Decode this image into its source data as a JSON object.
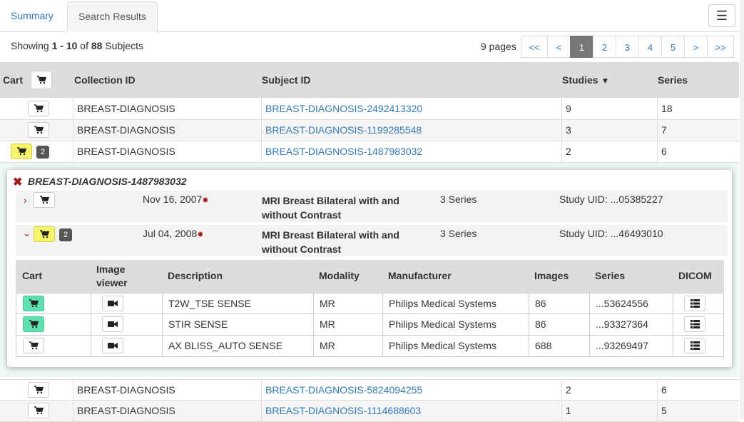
{
  "tabs": [
    {
      "label": "Summary"
    },
    {
      "label": "Search Results"
    }
  ],
  "results": {
    "showing_prefix": "Showing ",
    "range": "1 - 10",
    "of": " of ",
    "total": "88",
    "suffix": " Subjects"
  },
  "pagination": {
    "pages_label": "9 pages",
    "first": "<<",
    "prev": "<",
    "pages": [
      "1",
      "2",
      "3",
      "4",
      "5"
    ],
    "next": ">",
    "last": ">>"
  },
  "table": {
    "headers": {
      "cart": "Cart",
      "collection": "Collection ID",
      "subject": "Subject ID",
      "studies": "Studies",
      "series": "Series"
    },
    "rows_top": [
      {
        "collection": "BREAST-DIAGNOSIS",
        "subject": "BREAST-DIAGNOSIS-2492413320",
        "studies": "9",
        "series": "18"
      },
      {
        "collection": "BREAST-DIAGNOSIS",
        "subject": "BREAST-DIAGNOSIS-1199285548",
        "studies": "3",
        "series": "7"
      },
      {
        "collection": "BREAST-DIAGNOSIS",
        "subject": "BREAST-DIAGNOSIS-1487983032",
        "studies": "2",
        "series": "6",
        "badge": "2"
      }
    ],
    "rows_bottom": [
      {
        "collection": "BREAST-DIAGNOSIS",
        "subject": "BREAST-DIAGNOSIS-5824094255",
        "studies": "2",
        "series": "6"
      },
      {
        "collection": "BREAST-DIAGNOSIS",
        "subject": "BREAST-DIAGNOSIS-1114688603",
        "studies": "1",
        "series": "5"
      }
    ]
  },
  "detail": {
    "title": "BREAST-DIAGNOSIS-1487983032",
    "studies": [
      {
        "date": "Nov 16, 2007",
        "star": "✸",
        "desc_line1": "MRI Breast Bilateral with and",
        "desc_line2": "without Contrast",
        "series": "3 Series",
        "uid": "Study UID: ...05385227"
      },
      {
        "date": "Jul 04, 2008",
        "star": "✸",
        "desc_line1": "MRI Breast Bilateral with and",
        "desc_line2": "without Contrast",
        "series": "3 Series",
        "uid": "Study UID: ...46493010",
        "badge": "2"
      }
    ],
    "series_headers": {
      "cart": "Cart",
      "viewer_line1": "Image",
      "viewer_line2": "viewer",
      "description": "Description",
      "modality": "Modality",
      "manufacturer": "Manufacturer",
      "images": "Images",
      "series": "Series",
      "dicom": "DICOM"
    },
    "series_rows": [
      {
        "description": "T2W_TSE SENSE",
        "modality": "MR",
        "manufacturer": "Philips Medical Systems",
        "images": "86",
        "series": "...53624556"
      },
      {
        "description": "STIR SENSE",
        "modality": "MR",
        "manufacturer": "Philips Medical Systems",
        "images": "86",
        "series": "...93327364"
      },
      {
        "description": "AX BLISS_AUTO SENSE",
        "modality": "MR",
        "manufacturer": "Philips Medical Systems",
        "images": "688",
        "series": "...93269497"
      }
    ]
  },
  "colors": {
    "link": "#337ab7",
    "close": "#a3191c",
    "in_cart_yellow": "#f7f36b",
    "in_cart_green": "#5fe0b0"
  }
}
